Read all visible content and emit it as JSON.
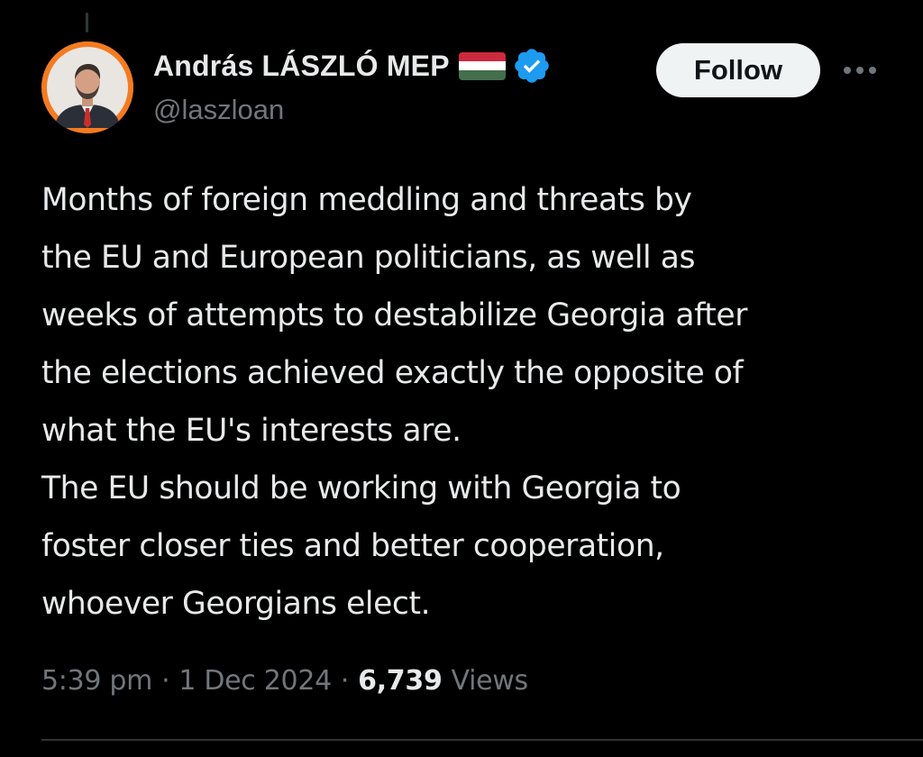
{
  "author": {
    "display_name": "András LÁSZLÓ MEP",
    "handle": "@laszloan",
    "flag_icon": "hungary-flag-icon",
    "verified_icon": "verified-badge-icon",
    "avatar_accent": "#f47b20"
  },
  "actions": {
    "follow_label": "Follow",
    "more_icon": "more-options-icon"
  },
  "tweet": {
    "text": "Months of foreign meddling and threats by\nthe EU and European politicians, as well as\nweeks of attempts to destabilize Georgia after\nthe elections achieved exactly the opposite of\nwhat the EU's interests are.\nThe EU should be working with Georgia to\nfoster closer ties and better cooperation,\nwhoever Georgians elect."
  },
  "meta": {
    "time": "5:39 pm",
    "separator": "·",
    "date": "1 Dec 2024",
    "views_count": "6,739",
    "views_label": "Views"
  },
  "colors": {
    "background": "#000000",
    "text_primary": "#e7e9ea",
    "text_secondary": "#71767b",
    "verified_blue": "#1d9bf0",
    "follow_bg": "#eff3f4"
  }
}
